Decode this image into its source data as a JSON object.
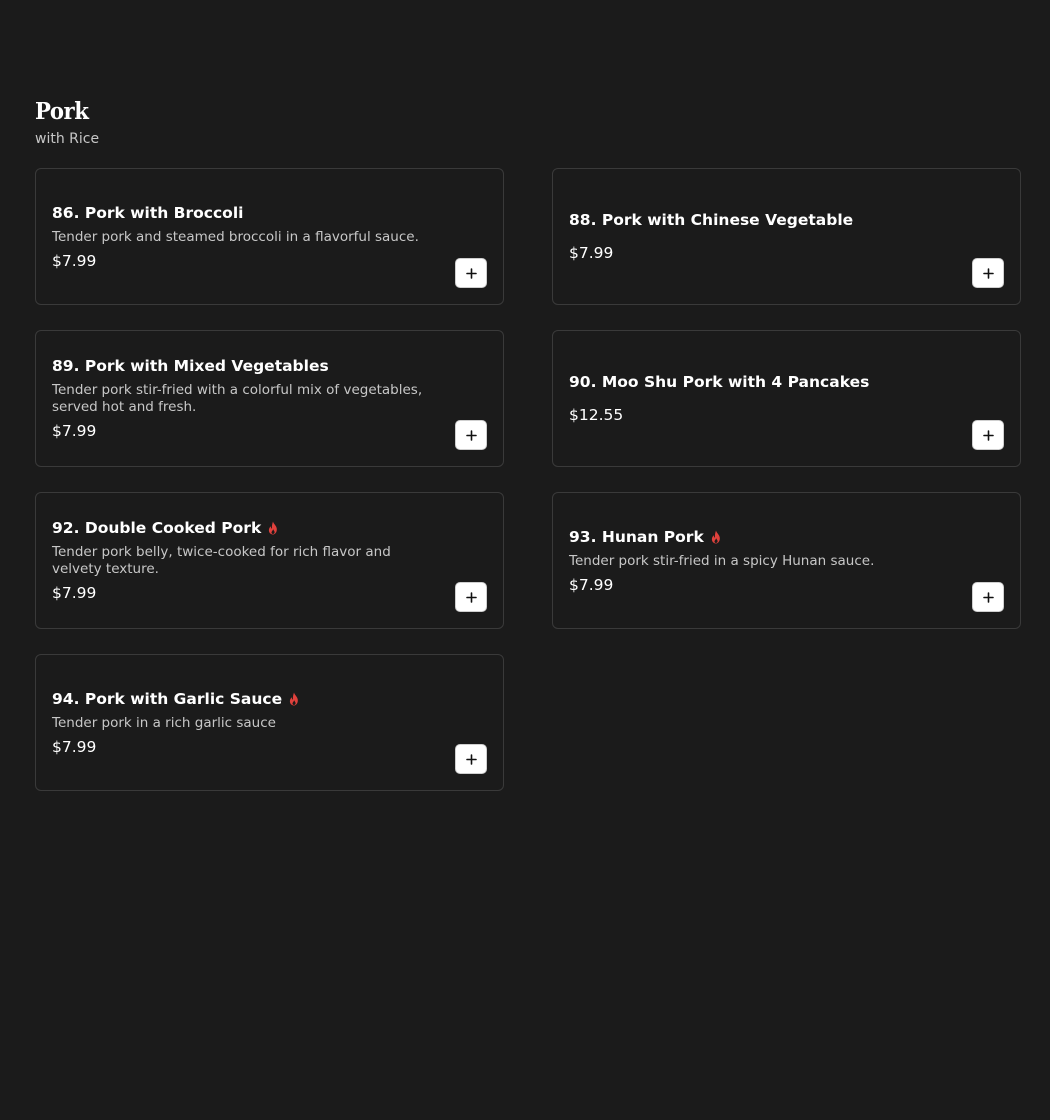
{
  "section": {
    "title": "Pork",
    "subtitle": "with Rice"
  },
  "colors": {
    "background": "#1b1b1b",
    "card_border": "#3a3a3a",
    "text_primary": "#ffffff",
    "text_secondary": "#c7c7c7",
    "spicy": "#e0413c",
    "button_bg": "#ffffff"
  },
  "items": [
    {
      "title": "86. Pork with Broccoli",
      "description": "Tender pork and steamed broccoli in a flavorful sauce.",
      "price": "$7.99",
      "spicy": false,
      "add_icon": "plus-icon"
    },
    {
      "title": "88. Pork with Chinese Vegetable",
      "description": "",
      "price": "$7.99",
      "spicy": false,
      "add_icon": "plus-icon"
    },
    {
      "title": "89. Pork with Mixed Vegetables",
      "description": "Tender pork stir-fried with a colorful mix of vegetables, served hot and fresh.",
      "price": "$7.99",
      "spicy": false,
      "add_icon": "plus-icon"
    },
    {
      "title": "90. Moo Shu Pork with 4 Pancakes",
      "description": "",
      "price": "$12.55",
      "spicy": false,
      "add_icon": "plus-icon"
    },
    {
      "title": "92. Double Cooked Pork",
      "description": "Tender pork belly, twice-cooked for rich flavor and velvety texture.",
      "price": "$7.99",
      "spicy": true,
      "spicy_icon": "flame-icon",
      "add_icon": "plus-icon"
    },
    {
      "title": "93. Hunan Pork",
      "description": "Tender pork stir-fried in a spicy Hunan sauce.",
      "price": "$7.99",
      "spicy": true,
      "spicy_icon": "flame-icon",
      "add_icon": "plus-icon"
    },
    {
      "title": "94. Pork with Garlic Sauce",
      "description": "Tender pork in a rich garlic sauce",
      "price": "$7.99",
      "spicy": true,
      "spicy_icon": "flame-icon",
      "add_icon": "plus-icon"
    }
  ]
}
